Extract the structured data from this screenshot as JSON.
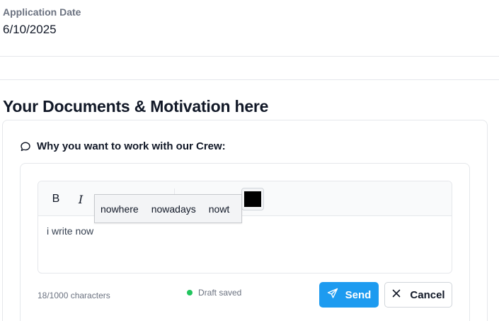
{
  "application_date": {
    "label": "Application Date",
    "value": "6/10/2025"
  },
  "section": {
    "title": "Your Documents & Motivation here"
  },
  "question": {
    "icon": "chat-bubble-icon",
    "label": "Why you want to work with our Crew:"
  },
  "toolbar": {
    "bold_label": "B",
    "italic_label": "I",
    "color_value": "#000000"
  },
  "editor": {
    "text": "i write now"
  },
  "spell_suggestions": [
    "nowhere",
    "nowadays",
    "nowt"
  ],
  "footer": {
    "char_count": "18/1000 characters",
    "draft_status": "Draft saved",
    "send_label": "Send",
    "cancel_label": "Cancel"
  },
  "colors": {
    "accent": "#1d9bf0",
    "draft_dot": "#22c55e"
  }
}
